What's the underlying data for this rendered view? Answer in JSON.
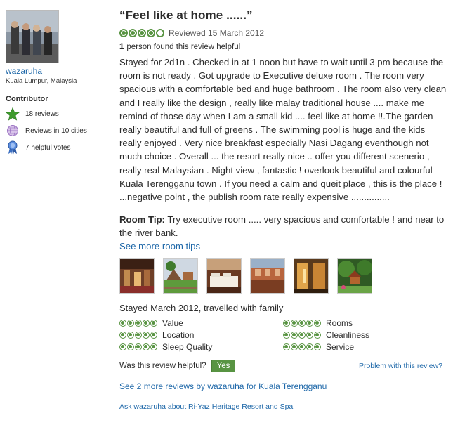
{
  "reviewer": {
    "username": "wazaruha",
    "location": "Kuala Lumpur, Malaysia",
    "badge_title": "Contributor",
    "badges": [
      {
        "icon": "star-icon",
        "label": "18 reviews"
      },
      {
        "icon": "globe-icon",
        "label": "Reviews in 10 cities"
      },
      {
        "icon": "ribbon-icon",
        "label": "7 helpful votes"
      }
    ]
  },
  "review": {
    "title": "“Feel like at home ......”",
    "rating": 4,
    "rating_max": 5,
    "reviewed_date": "Reviewed 15 March 2012",
    "helpful_count": "1",
    "helpful_text": "person found this review helpful",
    "body": "Stayed for 2d1n . Checked in at 1 noon but have to wait until 3 pm because the room is not ready . Got upgrade to Executive deluxe room . The room very spacious with a comfortable bed and huge bathroom . The room also very clean and I really like the design , really like malay traditional house .... make me remind of those day when I am a small kid .... feel like at home !!.The garden really beautiful and full of greens . The swimming pool is huge and the kids really enjoyed . Very nice breakfast especially Nasi Dagang eventhough not much choice . Overall ... the resort really nice .. offer you different scenerio , really real Malaysian . Night view , fantastic ! overlook beautiful and colourful Kuala Terengganu town . If you need a calm and queit place , this is the place ! ...negative point , the publish room rate really expensive ...............",
    "room_tip_label": "Room Tip:",
    "room_tip": "Try executive room ..... very spacious and comfortable ! and near to the river bank.",
    "more_tips_link": "See more room tips",
    "stayed": "Stayed March 2012, travelled with family",
    "subratings": [
      {
        "label": "Value",
        "rating": 5
      },
      {
        "label": "Rooms",
        "rating": 5
      },
      {
        "label": "Location",
        "rating": 5
      },
      {
        "label": "Cleanliness",
        "rating": 5
      },
      {
        "label": "Sleep Quality",
        "rating": 5
      },
      {
        "label": "Service",
        "rating": 5
      }
    ],
    "helpful_question": "Was this review helpful?",
    "yes_button": "Yes",
    "problem_link": "Problem with this review?",
    "more_reviews_link": "See 2 more reviews by wazaruha for Kuala Terengganu",
    "ask_link": "Ask wazaruha about Ri-Yaz Heritage Resort and Spa"
  },
  "colors": {
    "bubble_green": "#589442",
    "link_blue": "#1d67a8",
    "text": "#2c2c2c"
  }
}
